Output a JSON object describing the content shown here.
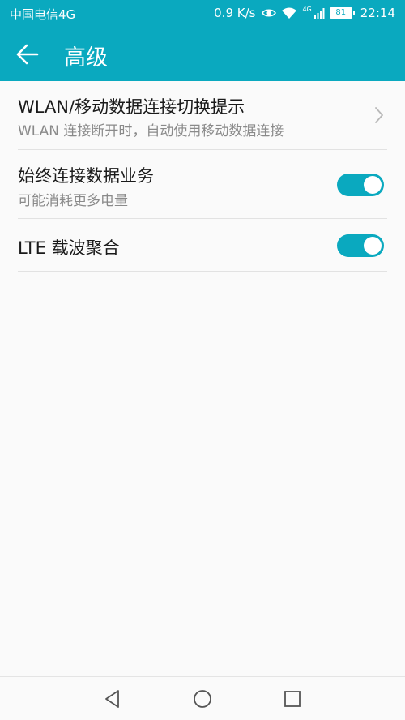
{
  "status_bar": {
    "carrier": "中国电信4G",
    "speed": "0.9 K/s",
    "network_badge": "4G",
    "battery": "81",
    "time": "22:14",
    "icons": [
      "eye-icon",
      "wifi-icon",
      "signal-icon",
      "battery-icon"
    ]
  },
  "app_bar": {
    "title": "高级",
    "back_icon": "arrow-left-icon"
  },
  "settings": [
    {
      "label": "WLAN/移动数据连接切换提示",
      "description": "WLAN 连接断开时，自动使用移动数据连接",
      "control": "chevron-right-icon"
    },
    {
      "label": "始终连接数据业务",
      "description": "可能消耗更多电量",
      "control": "toggle",
      "enabled": true
    },
    {
      "label": "LTE 载波聚合",
      "control": "toggle",
      "enabled": true
    }
  ],
  "nav_bar": {
    "icons": [
      "nav-back-icon",
      "nav-home-icon",
      "nav-recents-icon"
    ]
  },
  "colors": {
    "accent": "#0aa9bf",
    "background": "#fafafa",
    "divider": "#e2e2e2",
    "subtext": "#8a8a8a"
  }
}
